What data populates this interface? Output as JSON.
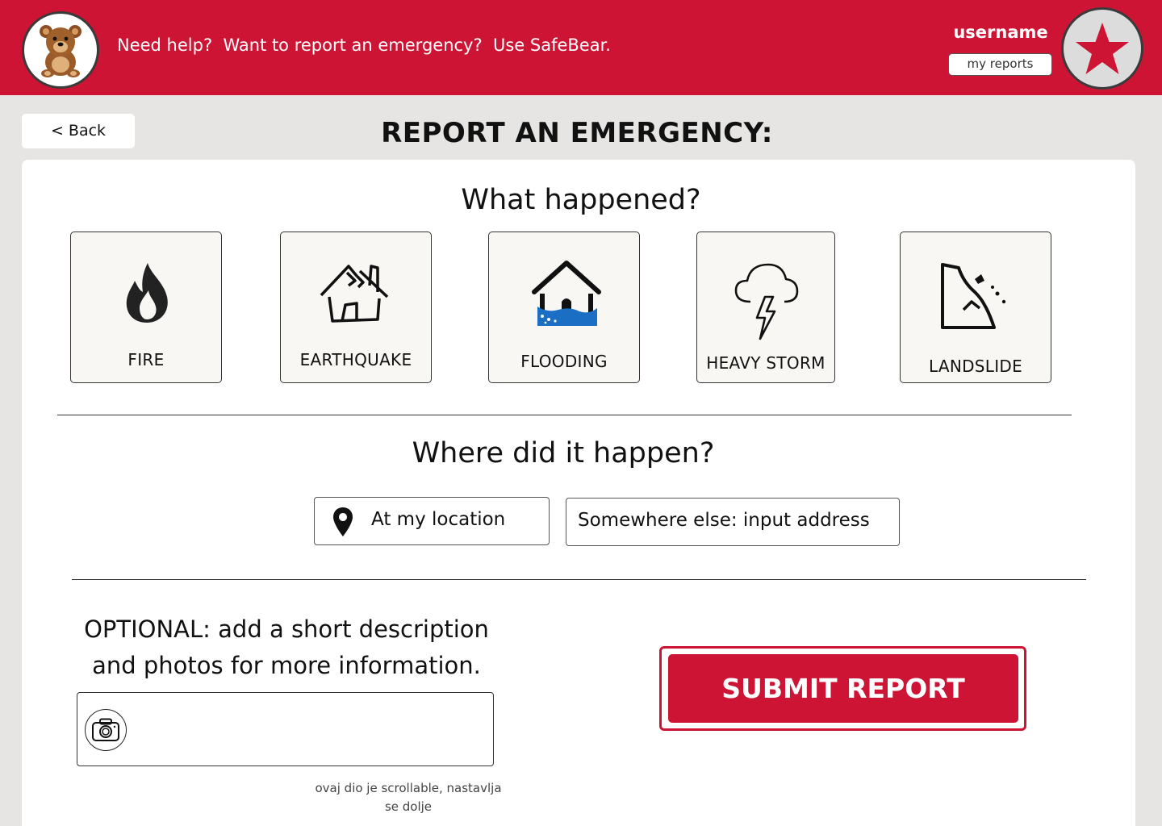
{
  "header": {
    "tagline": "Need help?  Want to report an emergency?  Use SafeBear.",
    "username": "username",
    "my_reports_label": "my reports",
    "logo_icon": "teddy-bear-icon",
    "avatar_icon": "star-icon"
  },
  "nav": {
    "back_label": "< Back"
  },
  "page": {
    "title": "REPORT AN EMERGENCY:"
  },
  "what": {
    "heading": "What happened?",
    "types": [
      {
        "label": "FIRE",
        "icon": "fire-icon"
      },
      {
        "label": "EARTHQUAKE",
        "icon": "earthquake-house-icon"
      },
      {
        "label": "FLOODING",
        "icon": "flood-house-icon"
      },
      {
        "label": "HEAVY STORM",
        "icon": "storm-cloud-icon"
      },
      {
        "label": "LANDSLIDE",
        "icon": "landslide-icon"
      }
    ]
  },
  "where": {
    "heading": "Where did it happen?",
    "my_location_label": "At my location",
    "other_address_label": "Somewhere else: input address"
  },
  "optional": {
    "line1": "OPTIONAL: add a short description",
    "line2": "and photos for more information.",
    "camera_icon": "camera-icon"
  },
  "submit_label": "SUBMIT REPORT",
  "note": "ovaj dio je scrollable, nastavlja se dolje",
  "colors": {
    "brand_red": "#cd1434",
    "background": "#e6e5e3",
    "tile_bg": "#f8f7f3",
    "flood_blue": "#1a6fc4"
  }
}
